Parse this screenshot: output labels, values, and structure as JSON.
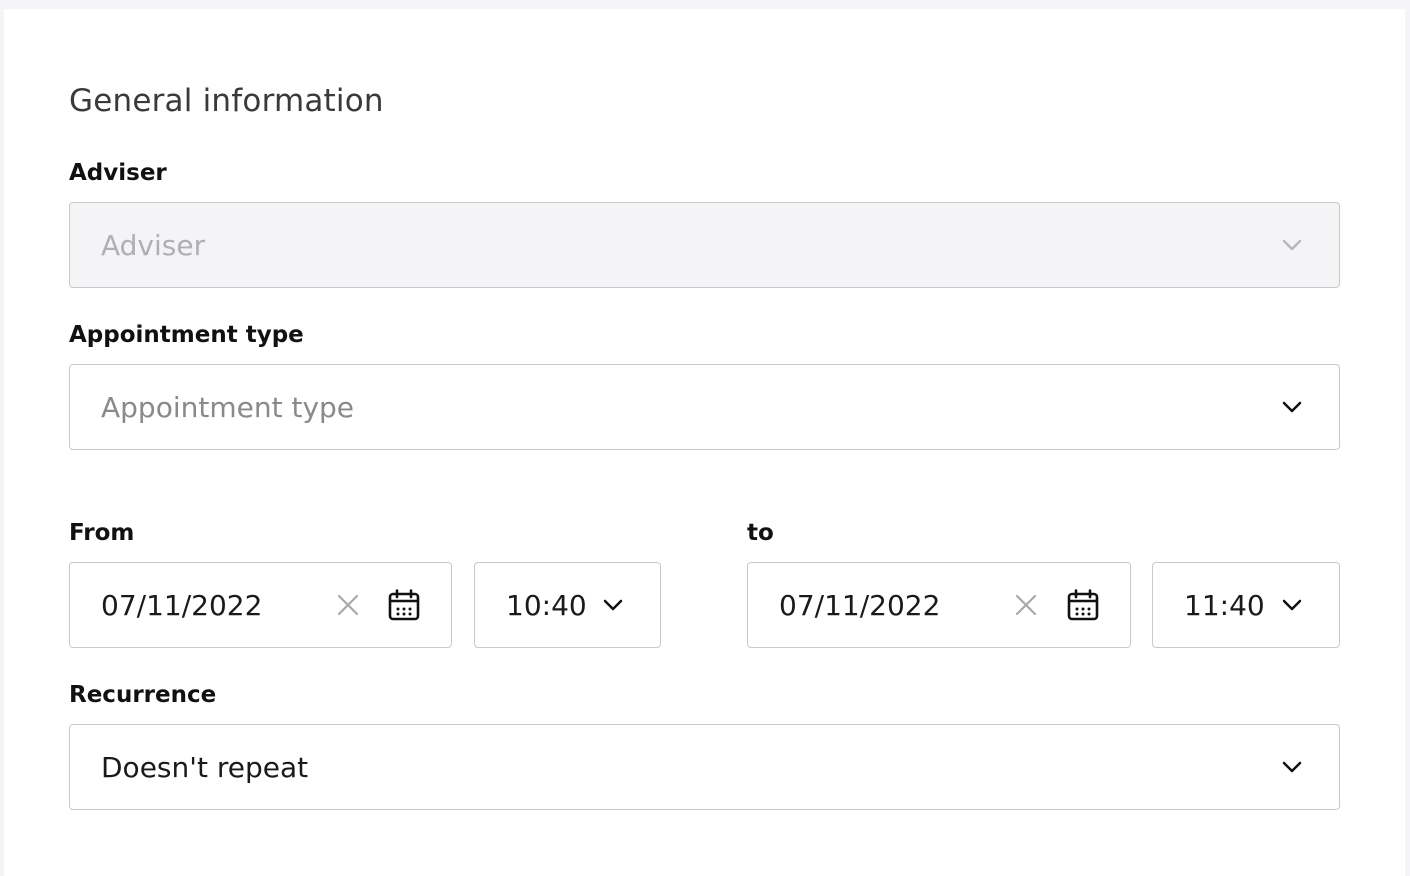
{
  "section": {
    "title": "General information"
  },
  "adviser": {
    "label": "Adviser",
    "placeholder": "Adviser",
    "disabled": true
  },
  "appointment_type": {
    "label": "Appointment type",
    "placeholder": "Appointment type"
  },
  "from": {
    "label": "From",
    "date": "07/11/2022",
    "time": "10:40"
  },
  "to": {
    "label": "to",
    "date": "07/11/2022",
    "time": "11:40"
  },
  "recurrence": {
    "label": "Recurrence",
    "value": "Doesn't repeat"
  },
  "icons": {
    "chevron": "chevron-down-icon",
    "clear": "close-icon",
    "calendar": "calendar-icon"
  },
  "colors": {
    "border": "#c9c9cc",
    "disabled_bg": "#f4f4f6",
    "page_bg": "#f5f5f7"
  }
}
